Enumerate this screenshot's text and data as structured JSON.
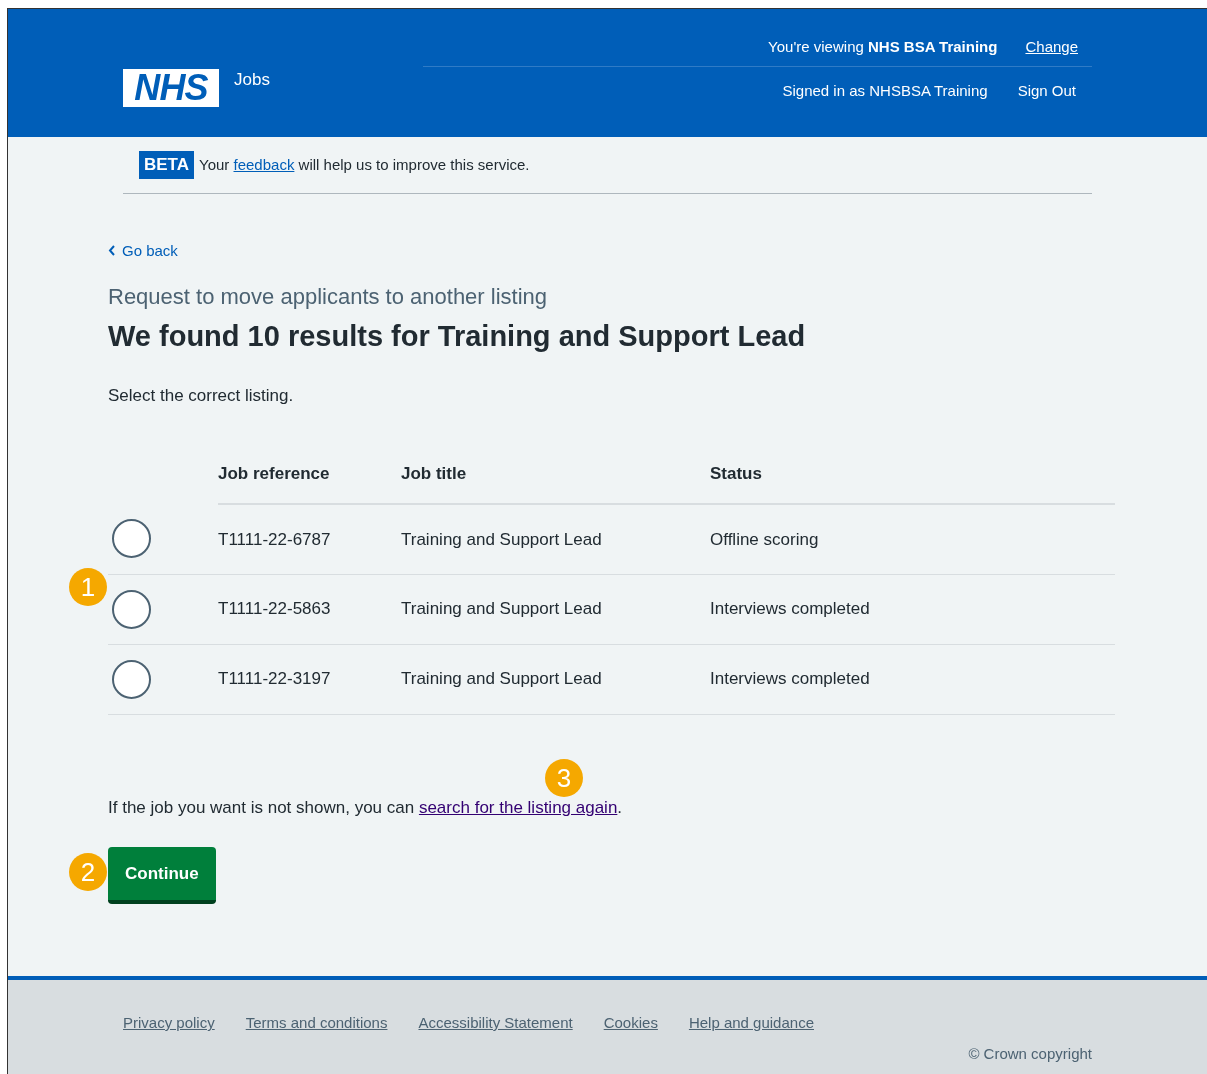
{
  "header": {
    "logo": "NHS",
    "service": "Jobs",
    "viewing_label": "You're viewing",
    "viewing_org": "NHS BSA Training",
    "change_link": "Change",
    "signed_in": "Signed in as NHSBSA Training",
    "sign_out": "Sign Out"
  },
  "beta_banner": {
    "tag": "BETA",
    "link": "feedback",
    "before": "Your",
    "after": "will help us to improve this service."
  },
  "back_link": "Go back",
  "caption": "Request to move applicants to another listing",
  "heading": "We found 10 results for Training and Support Lead",
  "hint": "Select the correct listing.",
  "table": {
    "columns": [
      "Job reference",
      "Job title",
      "Status"
    ],
    "rows": [
      {
        "selected": false,
        "cells": [
          "T1111-22-6787",
          "Training and Support Lead",
          "Offline scoring"
        ]
      },
      {
        "selected": false,
        "cells": [
          "T1111-22-5863",
          "Training and Support Lead",
          "Interviews completed"
        ]
      },
      {
        "selected": false,
        "cells": [
          "T1111-22-3197",
          "Training and Support Lead",
          "Interviews completed"
        ]
      }
    ]
  },
  "not_shown": {
    "before": "If the job you want is not shown, you can",
    "link": "search for the listing again",
    "after": "."
  },
  "continue_button": "Continue",
  "callouts": [
    "1",
    "2",
    "3"
  ],
  "footer": {
    "links": [
      "Privacy policy",
      "Terms and conditions",
      "Accessibility Statement",
      "Cookies",
      "Help and guidance"
    ],
    "copyright": "© Crown copyright"
  }
}
